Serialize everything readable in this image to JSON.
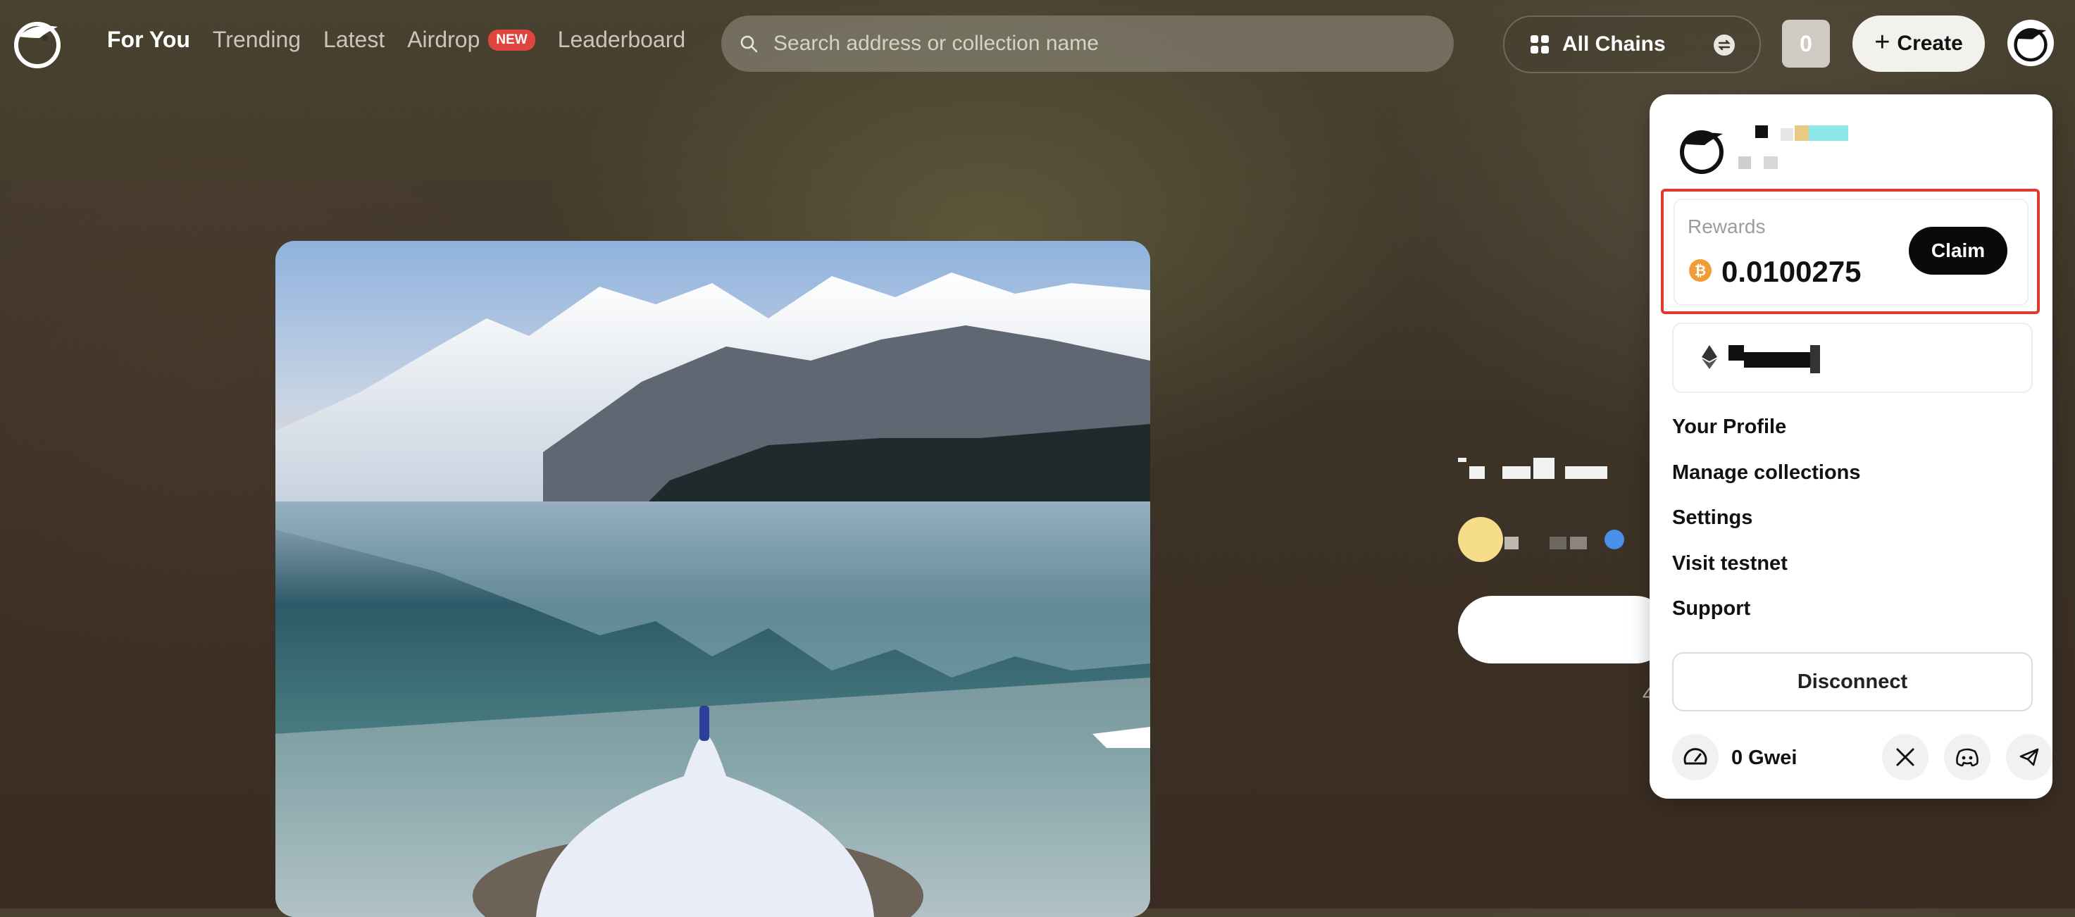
{
  "header": {
    "nav": [
      {
        "label": "For You",
        "active": true
      },
      {
        "label": "Trending"
      },
      {
        "label": "Latest"
      },
      {
        "label": "Airdrop",
        "badge": "NEW"
      },
      {
        "label": "Leaderboard"
      }
    ],
    "search": {
      "placeholder": "Search address or collection name",
      "icon": "search-icon"
    },
    "chains": {
      "label": "All Chains",
      "icon": "grid-icon"
    },
    "counter": "0",
    "create_label": "Create",
    "colors": {
      "badge": "#e0443f",
      "accent_red": "#e2382f"
    }
  },
  "panel": {
    "rewards": {
      "label": "Rewards",
      "value": "0.0100275",
      "currency_icon": "bitcoin-icon",
      "claim_label": "Claim"
    },
    "wallet": {
      "chain_icon": "ethereum-icon"
    },
    "menu": [
      "Your Profile",
      "Manage collections",
      "Settings",
      "Visit testnet",
      "Support"
    ],
    "disconnect_label": "Disconnect",
    "gas": {
      "value": "0 Gwei",
      "icon": "gauge-icon"
    },
    "social_icons": [
      "x-icon",
      "discord-icon",
      "telegram-icon"
    ]
  },
  "main": {
    "partial_text": "4"
  }
}
